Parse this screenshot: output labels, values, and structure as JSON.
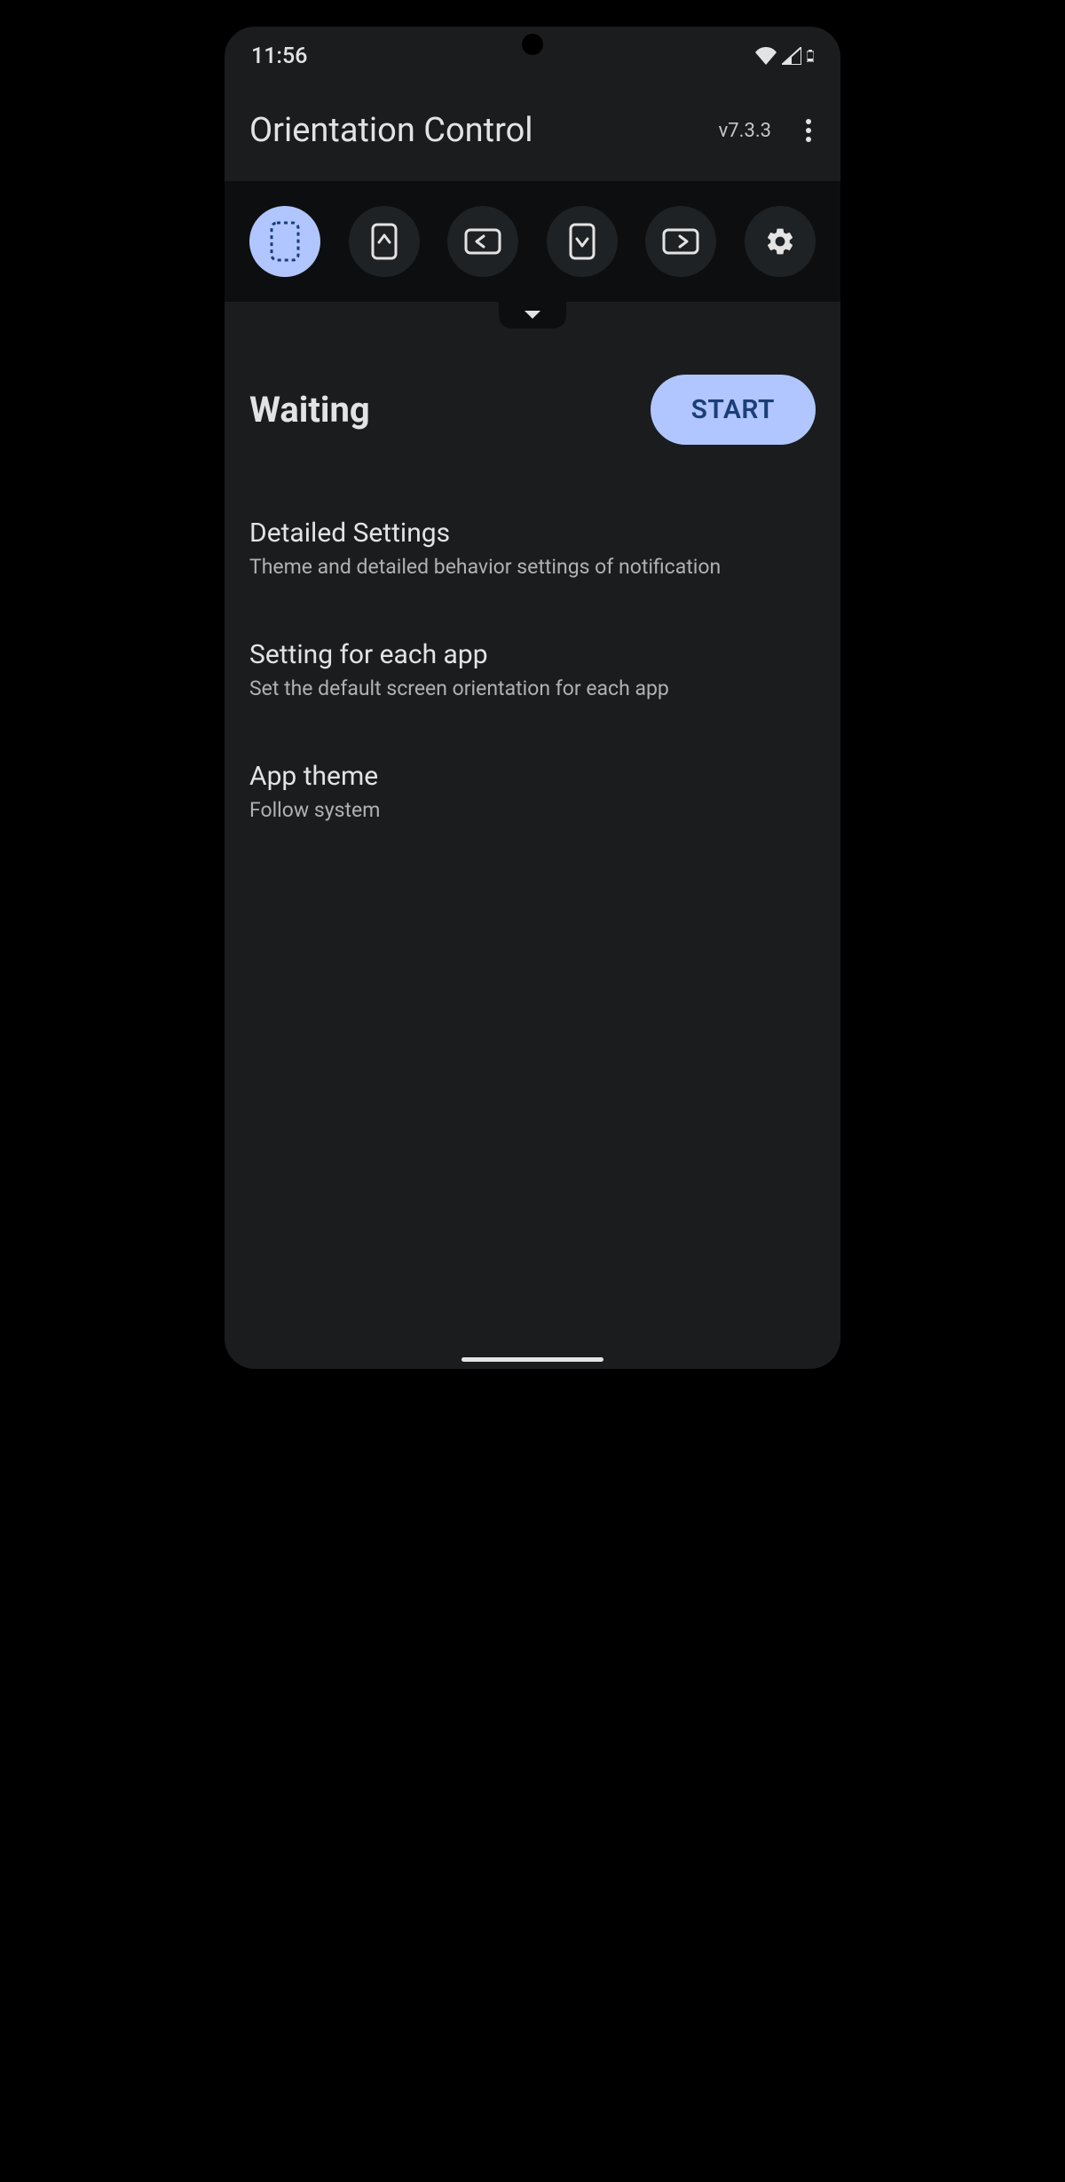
{
  "statusbar": {
    "time": "11:56"
  },
  "appbar": {
    "title": "Orientation Control",
    "version": "v7.3.3"
  },
  "orientation_icons": [
    "auto-dashed",
    "portrait-up",
    "landscape-left",
    "portrait-down",
    "landscape-right",
    "settings"
  ],
  "status": {
    "label": "Waiting",
    "button": "START"
  },
  "settings": [
    {
      "title": "Detailed Settings",
      "subtitle": "Theme and detailed behavior settings of notification"
    },
    {
      "title": "Setting for each app",
      "subtitle": "Set the default screen orientation for each app"
    },
    {
      "title": "App theme",
      "subtitle": "Follow system"
    }
  ],
  "colors": {
    "accent": "#b1c6ff",
    "background": "#1a1c1e",
    "bar_bg": "#0c0e10",
    "text": "#e3e3e3",
    "text_sub": "#b1b1b1",
    "button_text": "#1b3e78"
  }
}
